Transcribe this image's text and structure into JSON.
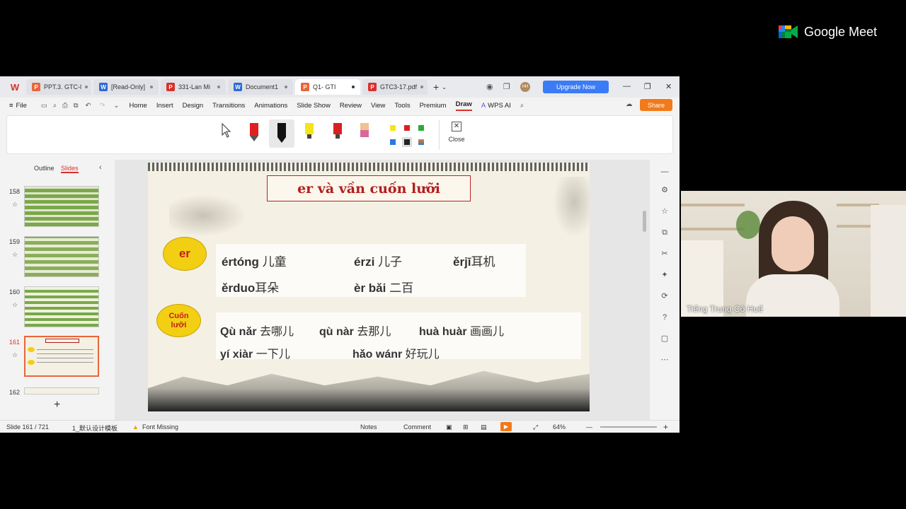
{
  "meet": {
    "brand": "Google Meet"
  },
  "tabs": [
    {
      "label": "PPT.3. GTC-l",
      "icon": "P",
      "color": "#e8663a"
    },
    {
      "label": "[Read-Only]",
      "icon": "W",
      "color": "#2d6ad6"
    },
    {
      "label": "331-Lan Mi",
      "icon": "P",
      "color": "#d9302b"
    },
    {
      "label": "Document1",
      "icon": "W",
      "color": "#2d6ad6"
    },
    {
      "label": "Q1- GTI",
      "icon": "P",
      "color": "#e8663a"
    },
    {
      "label": "GTC3-17.pdf",
      "icon": "P",
      "color": "#d9302b"
    }
  ],
  "toolbar": {
    "upgrade_label": "Upgrade Now",
    "avatar": "HH",
    "share_label": "Share"
  },
  "menu": {
    "file": "File",
    "items": [
      "Home",
      "Insert",
      "Design",
      "Transitions",
      "Animations",
      "Slide Show",
      "Review",
      "View",
      "Tools",
      "Premium",
      "Draw",
      "WPS AI"
    ],
    "active": "Draw"
  },
  "ribbon": {
    "close_label": "Close"
  },
  "panel": {
    "outline_tab": "Outline",
    "slides_tab": "Slides",
    "thumbs": [
      "158",
      "159",
      "160",
      "161",
      "162"
    ],
    "selected": "161"
  },
  "slide": {
    "title": "er và vần cuốn lưỡi",
    "oval1": "er",
    "oval2_line1": "Cuốn",
    "oval2_line2": "lưỡi",
    "row1": [
      {
        "pinyin": "értóng",
        "hanzi": " 儿童"
      },
      {
        "pinyin": "érzi",
        "hanzi": " 儿子"
      },
      {
        "pinyin": "ěrjī",
        "hanzi": "耳机"
      }
    ],
    "row2": [
      {
        "pinyin": "ěrduo",
        "hanzi": "耳朵"
      },
      {
        "pinyin": "èr bǎi",
        "hanzi": " 二百"
      }
    ],
    "row3": [
      {
        "pinyin": "Qù nǎr",
        "hanzi": " 去哪儿"
      },
      {
        "pinyin": "qù nàr",
        "hanzi": " 去那儿"
      },
      {
        "pinyin": "huà huàr",
        "hanzi": " 画画儿"
      }
    ],
    "row4": [
      {
        "pinyin": "yí xiàr",
        "hanzi": " 一下儿"
      },
      {
        "pinyin": "hǎo wánr",
        "hanzi": " 好玩儿"
      }
    ]
  },
  "status": {
    "slide": "Slide 161 / 721",
    "template": "1_默认设计模板",
    "font": "Font Missing",
    "notes": "Notes",
    "comment": "Comment",
    "zoom": "64%"
  },
  "video": {
    "name": "Tiếng Trung Cô Huế"
  }
}
